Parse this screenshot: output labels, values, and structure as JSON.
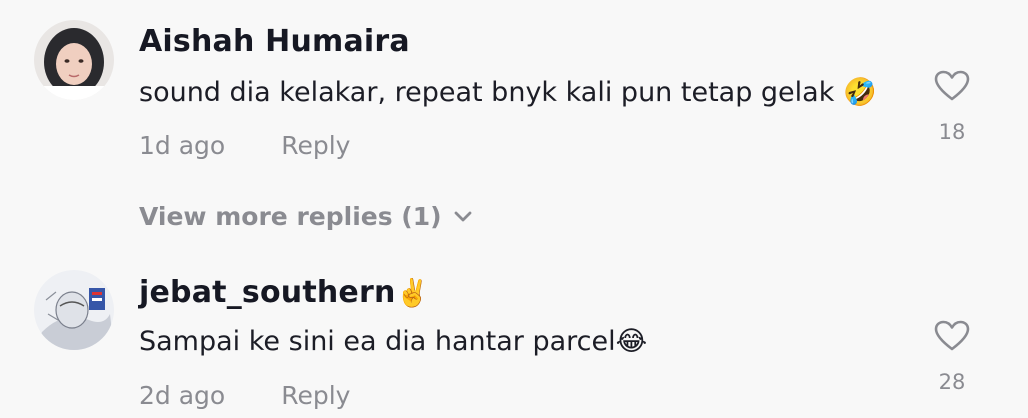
{
  "comments": [
    {
      "username": "Aishah Humaira",
      "username_emoji": "",
      "text": "sound dia kelakar, repeat bnyk kali pun tetap gelak",
      "text_emoji": "🤣",
      "time": "1d ago",
      "reply_label": "Reply",
      "likes": "18",
      "avatar_icon": "avatar-photo-woman-hijab"
    },
    {
      "username": "jebat_southern",
      "username_emoji": "✌️",
      "text": "Sampai ke sini ea dia hantar parcel",
      "text_emoji": "😂",
      "time": "2d ago",
      "reply_label": "Reply",
      "likes": "28",
      "avatar_icon": "avatar-photo-sketch"
    }
  ],
  "view_more": {
    "label": "View more replies (1)",
    "icon": "chevron-down-icon"
  },
  "colors": {
    "background": "#f8f8f8",
    "primary_text": "#161823",
    "secondary_text": "#8a8b91"
  }
}
